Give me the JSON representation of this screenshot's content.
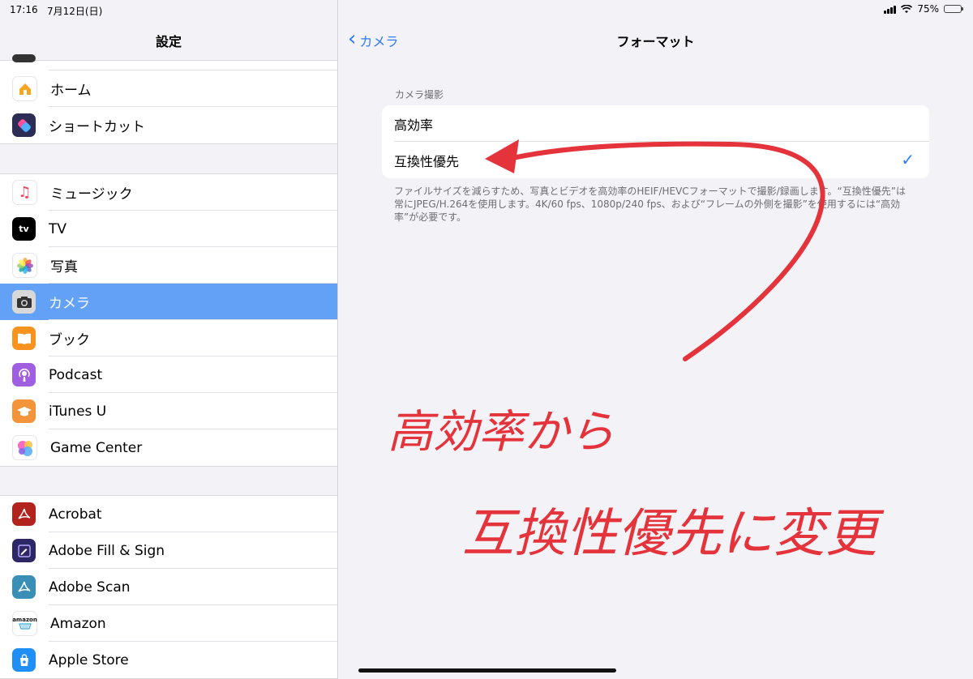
{
  "status": {
    "time": "17:16",
    "date": "7月12日(日)",
    "battery": "75%",
    "battery_level": 0.75
  },
  "sidebar": {
    "title": "設定",
    "groups": [
      {
        "items": [
          {
            "label": "ホーム",
            "icon": "home-icon",
            "color": "#ffffff"
          },
          {
            "label": "ショートカット",
            "icon": "shortcuts-icon",
            "color": "#2c2c54"
          }
        ]
      },
      {
        "items": [
          {
            "label": "ミュージック",
            "icon": "music-icon",
            "color": "#ffffff"
          },
          {
            "label": "TV",
            "icon": "tv-icon",
            "color": "#000000",
            "glyph": "tv"
          },
          {
            "label": "写真",
            "icon": "photos-icon",
            "color": "#ffffff"
          },
          {
            "label": "カメラ",
            "icon": "camera-icon",
            "color": "#d8d8d8",
            "selected": true
          },
          {
            "label": "ブック",
            "icon": "books-icon",
            "color": "#f7931e"
          },
          {
            "label": "Podcast",
            "icon": "podcast-icon",
            "color": "#a05fe0"
          },
          {
            "label": "iTunes U",
            "icon": "itunes-u-icon",
            "color": "#f3933a"
          },
          {
            "label": "Game Center",
            "icon": "game-center-icon",
            "color": "#ffffff"
          }
        ]
      },
      {
        "items": [
          {
            "label": "Acrobat",
            "icon": "acrobat-icon",
            "color": "#b3231e"
          },
          {
            "label": "Adobe Fill & Sign",
            "icon": "adobe-fill-sign-icon",
            "color": "#2d2766"
          },
          {
            "label": "Adobe Scan",
            "icon": "adobe-scan-icon",
            "color": "#3a8fb7"
          },
          {
            "label": "Amazon",
            "icon": "amazon-icon",
            "color": "#ffffff",
            "glyph": "amazon"
          },
          {
            "label": "Apple Store",
            "icon": "apple-store-icon",
            "color": "#1f8ff5"
          }
        ]
      }
    ]
  },
  "detail": {
    "back_label": "カメラ",
    "title": "フォーマット",
    "section_header": "カメラ撮影",
    "options": [
      {
        "label": "高効率",
        "checked": false
      },
      {
        "label": "互換性優先",
        "checked": true
      }
    ],
    "footer": "ファイルサイズを減らすため、写真とビデオを高効率のHEIF/HEVCフォーマットで撮影/録画します。“互換性優先”は常にJPEG/H.264を使用します。4K/60 fps、1080p/240 fps、および“フレームの外側を撮影”を使用するには“高効率”が必要です。"
  },
  "annotation": {
    "line1": "高効率から",
    "line2": "互換性優先に変更",
    "color": "#e5333b"
  }
}
